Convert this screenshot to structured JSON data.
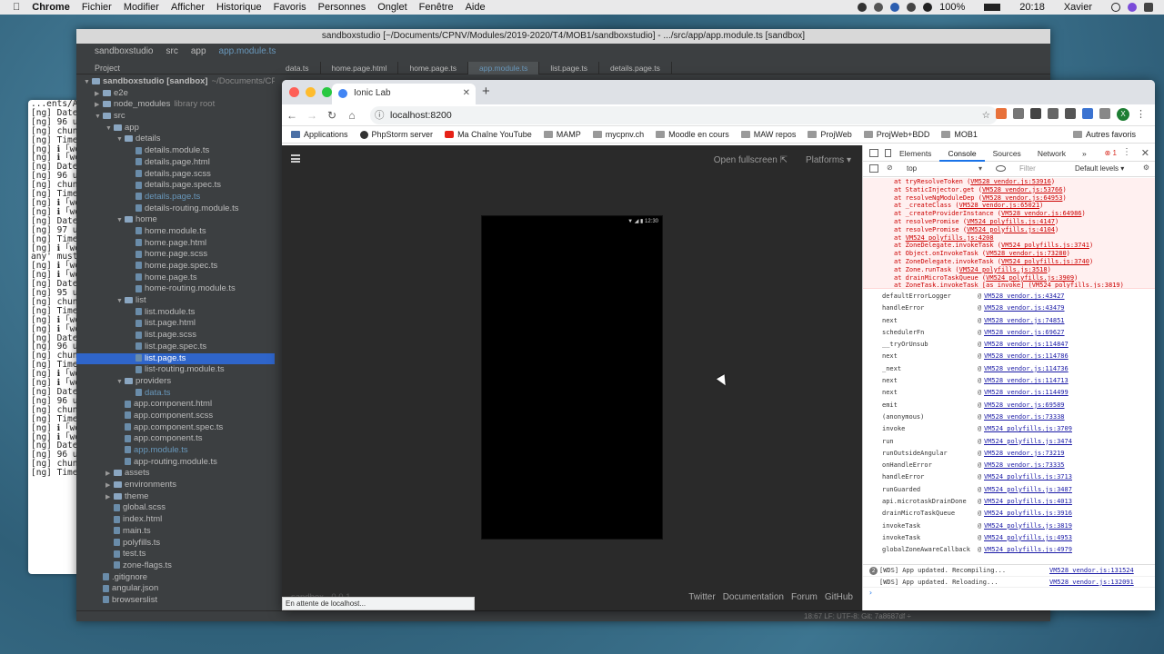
{
  "menubar": {
    "items": [
      "Chrome",
      "Fichier",
      "Modifier",
      "Afficher",
      "Historique",
      "Favoris",
      "Personnes",
      "Onglet",
      "Fenêtre",
      "Aide"
    ],
    "battery": "100%",
    "clock": "20:18",
    "user": "Xavier"
  },
  "terminal": {
    "lines": [
      "",
      "",
      "...ents/An",
      "",
      "[ng] Date:",
      "[ng] 96 un",
      "[ng] chunk",
      "[ng] Time:",
      "[ng] ℹ ｢wd",
      "[ng] ℹ ｢wd",
      "[ng] Date:",
      "[ng] 96 un",
      "[ng] chunk",
      "[ng] Time:",
      "[ng] ℹ ｢wd",
      "[ng] ℹ ｢wd",
      "[ng] Date:",
      "[ng] 97 un",
      "[ng] Time:",
      "[ng] ℹ ｢wd",
      "",
      "",
      "any' must",
      "",
      "[ng] ℹ ｢wd",
      "[ng] ℹ ｢wd",
      "",
      "",
      "[ng] Date:",
      "[ng] 95 un",
      "[ng] chunk",
      "[ng] Time:",
      "[ng] ℹ ｢wd",
      "[ng] ℹ ｢wd",
      "[ng] Date:",
      "[ng] 96 un",
      "[ng] chunk",
      "[ng] Time:",
      "[ng] ℹ ｢wd",
      "[ng] ℹ ｢wd",
      "[ng] Date:",
      "[ng] 96 un",
      "[ng] chunk",
      "[ng] Time:",
      "[ng] ℹ ｢wd",
      "[ng] ℹ ｢wd",
      "[ng] Date:",
      "[ng] 96 un",
      "[ng] chunk",
      "[ng] Time:"
    ]
  },
  "ide": {
    "title": "sandboxstudio [~/Documents/CPNV/Modules/2019-2020/T4/MOB1/sandboxstudio] - .../src/app/app.module.ts [sandbox]",
    "breadcrumb": [
      "sandboxstudio",
      "src",
      "app",
      "app.module.ts"
    ],
    "project_label": "Project",
    "tabs": [
      "data.ts",
      "home.page.html",
      "home.page.ts",
      "app.module.ts",
      "list.page.ts",
      "details.page.ts"
    ],
    "active_tab": "app.module.ts",
    "tree": [
      {
        "label": "sandboxstudio [sandbox]",
        "hint": "~/Documents/CPNV...",
        "level": 0,
        "type": "dir",
        "open": true
      },
      {
        "label": "e2e",
        "level": 1,
        "type": "dir"
      },
      {
        "label": "node_modules",
        "hint": "library root",
        "level": 1,
        "type": "dir"
      },
      {
        "label": "src",
        "level": 1,
        "type": "dir",
        "open": true
      },
      {
        "label": "app",
        "level": 2,
        "type": "dir",
        "open": true
      },
      {
        "label": "details",
        "level": 3,
        "type": "dir",
        "open": true
      },
      {
        "label": "details.module.ts",
        "level": 4,
        "type": "file"
      },
      {
        "label": "details.page.html",
        "level": 4,
        "type": "file"
      },
      {
        "label": "details.page.scss",
        "level": 4,
        "type": "file"
      },
      {
        "label": "details.page.spec.ts",
        "level": 4,
        "type": "file"
      },
      {
        "label": "details.page.ts",
        "level": 4,
        "type": "file",
        "blue": true
      },
      {
        "label": "details-routing.module.ts",
        "level": 4,
        "type": "file"
      },
      {
        "label": "home",
        "level": 3,
        "type": "dir",
        "open": true
      },
      {
        "label": "home.module.ts",
        "level": 4,
        "type": "file"
      },
      {
        "label": "home.page.html",
        "level": 4,
        "type": "file"
      },
      {
        "label": "home.page.scss",
        "level": 4,
        "type": "file"
      },
      {
        "label": "home.page.spec.ts",
        "level": 4,
        "type": "file"
      },
      {
        "label": "home.page.ts",
        "level": 4,
        "type": "file"
      },
      {
        "label": "home-routing.module.ts",
        "level": 4,
        "type": "file"
      },
      {
        "label": "list",
        "level": 3,
        "type": "dir",
        "open": true
      },
      {
        "label": "list.module.ts",
        "level": 4,
        "type": "file"
      },
      {
        "label": "list.page.html",
        "level": 4,
        "type": "file"
      },
      {
        "label": "list.page.scss",
        "level": 4,
        "type": "file"
      },
      {
        "label": "list.page.spec.ts",
        "level": 4,
        "type": "file"
      },
      {
        "label": "list.page.ts",
        "level": 4,
        "type": "file",
        "selected": true
      },
      {
        "label": "list-routing.module.ts",
        "level": 4,
        "type": "file"
      },
      {
        "label": "providers",
        "level": 3,
        "type": "dir",
        "open": true
      },
      {
        "label": "data.ts",
        "level": 4,
        "type": "file",
        "blue": true
      },
      {
        "label": "app.component.html",
        "level": 3,
        "type": "file"
      },
      {
        "label": "app.component.scss",
        "level": 3,
        "type": "file"
      },
      {
        "label": "app.component.spec.ts",
        "level": 3,
        "type": "file"
      },
      {
        "label": "app.component.ts",
        "level": 3,
        "type": "file"
      },
      {
        "label": "app.module.ts",
        "level": 3,
        "type": "file",
        "blue": true
      },
      {
        "label": "app-routing.module.ts",
        "level": 3,
        "type": "file"
      },
      {
        "label": "assets",
        "level": 2,
        "type": "dir"
      },
      {
        "label": "environments",
        "level": 2,
        "type": "dir"
      },
      {
        "label": "theme",
        "level": 2,
        "type": "dir"
      },
      {
        "label": "global.scss",
        "level": 2,
        "type": "file"
      },
      {
        "label": "index.html",
        "level": 2,
        "type": "file"
      },
      {
        "label": "main.ts",
        "level": 2,
        "type": "file"
      },
      {
        "label": "polyfills.ts",
        "level": 2,
        "type": "file"
      },
      {
        "label": "test.ts",
        "level": 2,
        "type": "file"
      },
      {
        "label": "zone-flags.ts",
        "level": 2,
        "type": "file"
      },
      {
        "label": ".gitignore",
        "level": 1,
        "type": "file"
      },
      {
        "label": "angular.json",
        "level": 1,
        "type": "file"
      },
      {
        "label": "browserslist",
        "level": 1,
        "type": "file"
      }
    ],
    "status": "18:67   LF:  UTF-8:  Git: 7a8687df ÷"
  },
  "chrome": {
    "tab_title": "Ionic Lab",
    "url": "localhost:8200",
    "bookmarks": [
      "Applications",
      "PhpStorm server",
      "Ma Chaîne YouTube",
      "MAMP",
      "mycpnv.ch",
      "Moodle en cours",
      "MAW repos",
      "ProjWeb",
      "ProjWeb+BDD",
      "MOB1"
    ],
    "other_bookmarks": "Autres favoris",
    "profile_initial": "X",
    "loading_status": "En attente de localhost..."
  },
  "ionic_lab": {
    "open_fullscreen": "Open fullscreen",
    "platforms": "Platforms",
    "phone_clock": "12:30",
    "version": "sandbox - 0.0.1",
    "footer_links": [
      "Twitter",
      "Documentation",
      "Forum",
      "GitHub"
    ]
  },
  "devtools": {
    "tabs": [
      "Elements",
      "Console",
      "Sources",
      "Network"
    ],
    "active_tab": "Console",
    "more": "»",
    "error_count": "1",
    "context": "top",
    "filter_placeholder": "Filter",
    "levels": "Default levels ▾",
    "error_lines": [
      {
        "t": "at tryResolveToken (",
        "l": "VM528 vendor.js:53916",
        "e": ")"
      },
      {
        "t": "at StaticInjector.get (",
        "l": "VM528 vendor.js:53766",
        "e": ")"
      },
      {
        "t": "at resolveNgModuleDep (",
        "l": "VM528 vendor.js:64953",
        "e": ")"
      },
      {
        "t": "at _createClass (",
        "l": "VM528 vendor.js:65021",
        "e": ")"
      },
      {
        "t": "at _createProviderInstance (",
        "l": "VM528 vendor.js:64986",
        "e": ")"
      },
      {
        "t": "at resolvePromise (",
        "l": "VM524 polyfills.js:4147",
        "e": ")"
      },
      {
        "t": "at resolvePromise (",
        "l": "VM524 polyfills.js:4104",
        "e": ")"
      },
      {
        "t": "at ",
        "l": "VM524 polyfills.js:4208",
        "e": ""
      },
      {
        "t": "at ZoneDelegate.invokeTask (",
        "l": "VM524 polyfills.js:3741",
        "e": ")"
      },
      {
        "t": "at Object.onInvokeTask (",
        "l": "VM528 vendor.js:73280",
        "e": ")"
      },
      {
        "t": "at ZoneDelegate.invokeTask (",
        "l": "VM524 polyfills.js:3740",
        "e": ")"
      },
      {
        "t": "at Zone.runTask (",
        "l": "VM524 polyfills.js:3518",
        "e": ")"
      },
      {
        "t": "at drainMicroTaskQueue (",
        "l": "VM524 polyfills.js:3909",
        "e": ")"
      },
      {
        "t": "at ZoneTask.invokeTask [as invoke] (",
        "l": "VM524 polyfills.js:3819",
        "e": ")"
      },
      {
        "t": "at invokeTask (",
        "l": "VM524 polyfills.js:4953",
        "e": ")"
      }
    ],
    "stack": [
      {
        "fn": "defaultErrorLogger",
        "src": "VM528 vendor.js:43427"
      },
      {
        "fn": "handleError",
        "src": "VM528 vendor.js:43479"
      },
      {
        "fn": "next",
        "src": "VM528 vendor.js:74851"
      },
      {
        "fn": "schedulerFn",
        "src": "VM528 vendor.js:69627"
      },
      {
        "fn": "__tryOrUnsub",
        "src": "VM528 vendor.js:114847"
      },
      {
        "fn": "next",
        "src": "VM528 vendor.js:114786"
      },
      {
        "fn": "_next",
        "src": "VM528 vendor.js:114736"
      },
      {
        "fn": "next",
        "src": "VM528 vendor.js:114713"
      },
      {
        "fn": "next",
        "src": "VM528 vendor.js:114499"
      },
      {
        "fn": "emit",
        "src": "VM528 vendor.js:69589"
      },
      {
        "fn": "(anonymous)",
        "src": "VM528 vendor.js:73338"
      },
      {
        "fn": "invoke",
        "src": "VM524 polyfills.js:3709"
      },
      {
        "fn": "run",
        "src": "VM524 polyfills.js:3474"
      },
      {
        "fn": "runOutsideAngular",
        "src": "VM528 vendor.js:73219"
      },
      {
        "fn": "onHandleError",
        "src": "VM528 vendor.js:73335"
      },
      {
        "fn": "handleError",
        "src": "VM524 polyfills.js:3713"
      },
      {
        "fn": "runGuarded",
        "src": "VM524 polyfills.js:3487"
      },
      {
        "fn": "api.microtaskDrainDone",
        "src": "VM524 polyfills.js:4013"
      },
      {
        "fn": "drainMicroTaskQueue",
        "src": "VM524 polyfills.js:3916"
      },
      {
        "fn": "invokeTask",
        "src": "VM524 polyfills.js:3819"
      },
      {
        "fn": "invokeTask",
        "src": "VM524 polyfills.js:4953"
      },
      {
        "fn": "globalZoneAwareCallback",
        "src": "VM524 polyfills.js:4979"
      }
    ],
    "messages": [
      {
        "badge": "2",
        "text": "[WDS] App updated. Recompiling...",
        "src": "VM528 vendor.js:131524"
      },
      {
        "badge": "",
        "text": "[WDS] App updated. Reloading...",
        "src": "VM528 vendor.js:132091"
      }
    ],
    "prompt": "›"
  },
  "colors": {
    "accent": "#1a73e8",
    "error": "#d93025",
    "ide_bg": "#3c3f41",
    "selection": "#2f65ca"
  }
}
